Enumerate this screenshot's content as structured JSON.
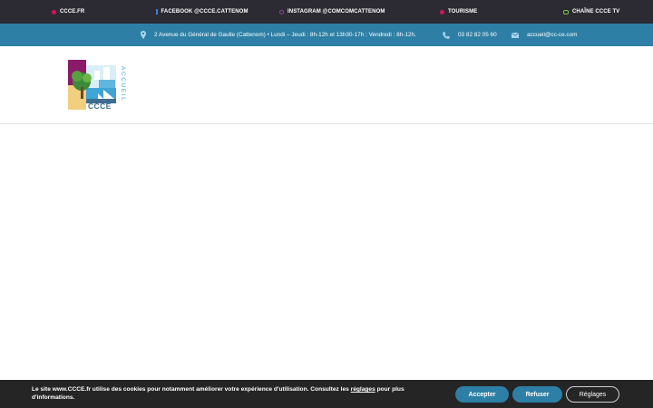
{
  "topbar": {
    "links": [
      {
        "label": "CCCE.FR",
        "icon": "globe-icon",
        "color": "#d4145a"
      },
      {
        "label": "FACEBOOK @CCCE.CATTENOM",
        "icon": "facebook-icon",
        "color": "#3b83c8"
      },
      {
        "label": "INSTAGRAM @COMCOMCATTENOM",
        "icon": "instagram-icon",
        "color": "#8e44ad"
      },
      {
        "label": "TOURISME",
        "icon": "camera-icon",
        "color": "#d4145a"
      },
      {
        "label": "CHAÎNE CCCE TV",
        "icon": "tv-icon",
        "color": "#7cc142"
      }
    ]
  },
  "infobar": {
    "address": "2 Avenue du Général de Gaulle (Cattenom) • Lundi – Jeudi : 8h-12h et 13h30-17h ; Vendredi : 8h-12h.",
    "phone": "03 82 82 05 60",
    "email": "accueil@cc-ce.com",
    "icon_color": "#a9d6ee"
  },
  "logo": {
    "text": "CCCE",
    "side_text": "ACCUEIL"
  },
  "cookie": {
    "message_before": "Le site www.CCCE.fr utilise des cookies pour notamment améliorer votre expérience d'utilisation. Consultez les ",
    "link": "réglages",
    "message_after": " pour plus d'informations.",
    "accept": "Accepter",
    "refuse": "Refuser",
    "settings": "Réglages"
  },
  "colors": {
    "topbar_bg": "#2c2a33",
    "accent_blue": "#2d7fa5",
    "cookie_bg": "#252525"
  }
}
